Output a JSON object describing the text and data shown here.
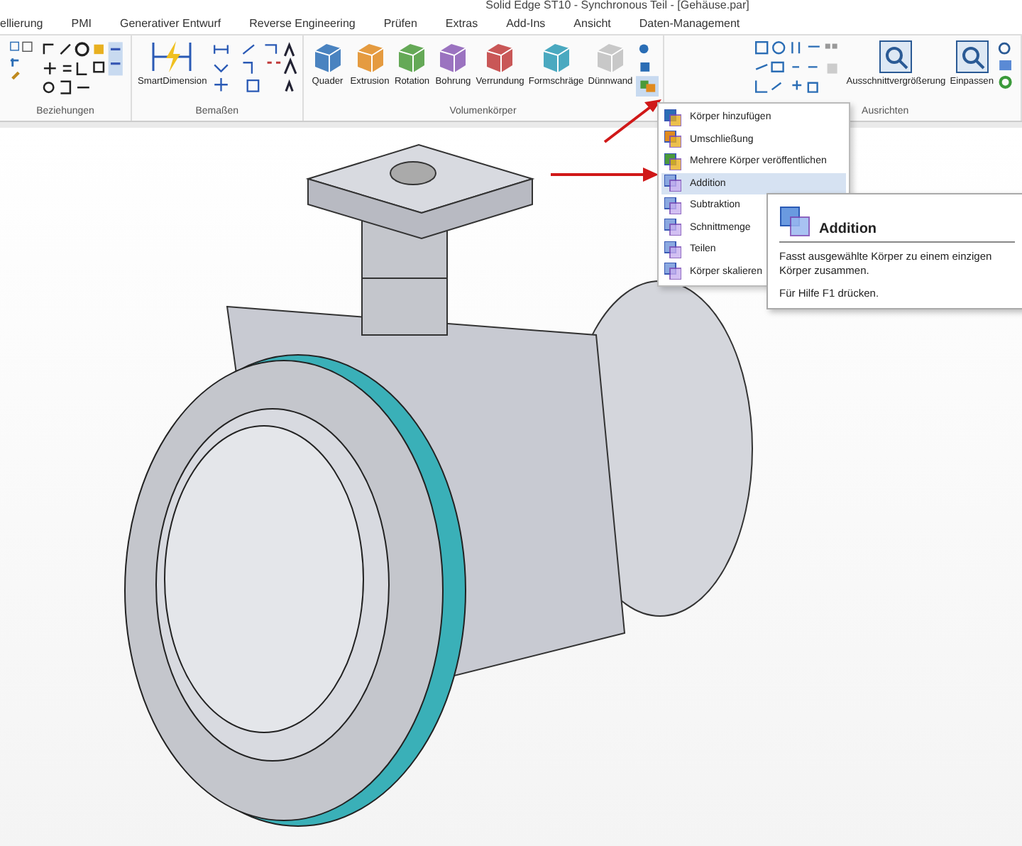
{
  "window": {
    "title": "Solid Edge ST10 - Synchronous Teil - [Gehäuse.par]"
  },
  "tabs": [
    {
      "label": "ellierung",
      "selected": false
    },
    {
      "label": "PMI",
      "selected": false
    },
    {
      "label": "Generativer Entwurf",
      "selected": false
    },
    {
      "label": "Reverse Engineering",
      "selected": false
    },
    {
      "label": "Prüfen",
      "selected": false
    },
    {
      "label": "Extras",
      "selected": false
    },
    {
      "label": "Add-Ins",
      "selected": false
    },
    {
      "label": "Ansicht",
      "selected": false
    },
    {
      "label": "Daten-Management",
      "selected": false
    }
  ],
  "ribbon": {
    "groups": [
      {
        "label": "Beziehungen",
        "kind": "relations"
      },
      {
        "label": "Bemaßen",
        "kind": "dimensions",
        "buttons": [
          "SmartDimension"
        ]
      },
      {
        "label": "Volumenkörper",
        "kind": "solids",
        "buttons": [
          "Quader",
          "Extrusion",
          "Rotation",
          "Bohrung",
          "Verrundung",
          "Formschräge",
          "Dünnwand"
        ]
      },
      {
        "label": "Ausrichten",
        "kind": "align",
        "buttons": [
          "Ausschnittvergrößerung",
          "Einpassen"
        ]
      }
    ]
  },
  "menu": {
    "items": [
      {
        "label": "Körper hinzufügen",
        "selected": false
      },
      {
        "label": "Umschließung",
        "selected": false
      },
      {
        "label": "Mehrere Körper veröffentlichen",
        "selected": false
      },
      {
        "label": "Addition",
        "selected": true
      },
      {
        "label": "Subtraktion",
        "selected": false
      },
      {
        "label": "Schnittmenge",
        "selected": false
      },
      {
        "label": "Teilen",
        "selected": false
      },
      {
        "label": "Körper skalieren",
        "selected": false
      }
    ]
  },
  "tooltip": {
    "title": "Addition",
    "description": "Fasst ausgewählte Körper zu einem einzigen Körper zusammen.",
    "hint": "Für Hilfe F1 drücken."
  }
}
